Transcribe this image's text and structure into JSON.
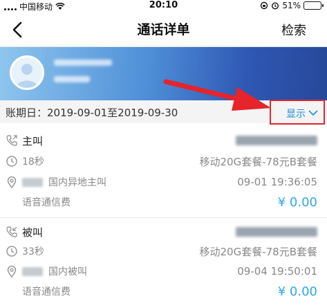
{
  "status_bar": {
    "carrier": "中国移动",
    "time": "20:10",
    "battery": "51%",
    "battery_level": 0.51
  },
  "nav": {
    "title": "通话详单",
    "search_label": "检索"
  },
  "bill": {
    "period": "账期日：2019-09-01至2019-09-30",
    "show_label": "显示"
  },
  "records": [
    {
      "direction": "主叫",
      "duration": "18秒",
      "plan": "移动20G套餐-78元B套餐",
      "call_type": "国内异地主叫",
      "datetime": "09-01 19:36:05",
      "fee_type": "语音通信费",
      "amount": "¥ 0.00"
    },
    {
      "direction": "被叫",
      "duration": "33秒",
      "plan": "移动20G套餐-78元B套餐",
      "call_type": "国内被叫",
      "datetime": "09-04 19:50:01",
      "fee_type": "语音通信费",
      "amount": "¥ 0.00"
    }
  ],
  "colors": {
    "accent": "#2fa8e6",
    "highlight_border": "#e5242b",
    "arrow": "#e5242b"
  }
}
